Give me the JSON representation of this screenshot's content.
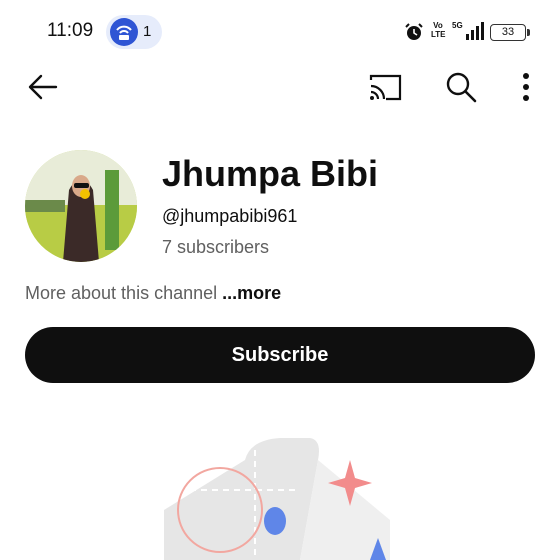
{
  "status_bar": {
    "time": "11:09",
    "hotspot_count": "1",
    "volte_top": "Vo",
    "volte_bottom": "LTE",
    "network": "5G",
    "battery": "33"
  },
  "top_bar": {
    "icons": [
      "back-arrow-icon",
      "cast-icon",
      "search-icon",
      "more-vertical-icon"
    ]
  },
  "channel": {
    "name": "Jhumpa Bibi",
    "handle": "@jhumpabibi961",
    "subscribers": "7 subscribers",
    "about_text": "More about this channel",
    "about_more": "...more",
    "subscribe_label": "Subscribe"
  },
  "colors": {
    "brand_button": "#0f0f0f",
    "secondary_text": "#606060",
    "hotspot_accent": "#2f55d4"
  }
}
